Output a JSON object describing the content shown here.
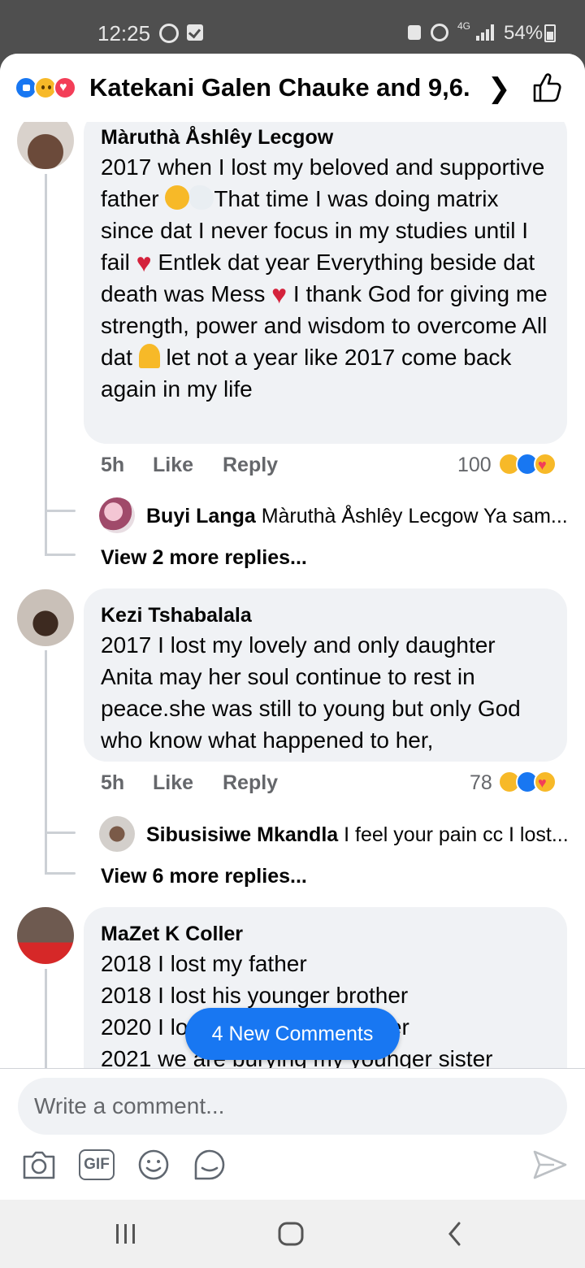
{
  "status_bar": {
    "time": "12:25",
    "network": "4G",
    "battery": "54%",
    "icons": [
      "whatsapp-icon",
      "notification-check-icon",
      "lock-icon",
      "alarm-icon",
      "signal-icon",
      "battery-icon"
    ]
  },
  "header": {
    "title": "Katekani Galen Chauke and 9,6...",
    "reactions": [
      "like",
      "sad",
      "love"
    ]
  },
  "comments": [
    {
      "author": "Màruthà Åshlêy Lecgow",
      "text_parts": [
        "2017 when I lost my beloved and supportive father ",
        "That time I was doing matrix since dat I never focus in my studies until I fail ",
        " Entlek dat year Everything beside dat death was Mess ",
        " I thank God for giving me strength, power and wisdom to overcome All dat ",
        " let not a year like 2017 come back again in my life"
      ],
      "time": "5h",
      "like": "Like",
      "reply": "Reply",
      "reaction_count": "100",
      "reply_preview": {
        "author": "Buyi Langa",
        "text": "Màruthà Åshlêy Lecgow Ya sam..."
      },
      "view_more": "View 2 more replies..."
    },
    {
      "author": "Kezi Tshabalala",
      "text": "2017 I lost my lovely and only daughter Anita may her soul continue to rest in peace.she was still to young but only God who know what happened to her,",
      "time": "5h",
      "like": "Like",
      "reply": "Reply",
      "reaction_count": "78",
      "reply_preview": {
        "author": "Sibusisiwe Mkandla",
        "text": "I feel your pain cc I lost..."
      },
      "view_more": "View 6 more replies..."
    },
    {
      "author": "MaZet K Coller",
      "lines": [
        "2018 I lost my father",
        "2018 I lost his younger brother",
        "2020 I lost my younger brother",
        "2021 we are burying my younger sister"
      ]
    }
  ],
  "new_comments_label": "4 New Comments",
  "composer": {
    "placeholder": "Write a comment...",
    "tools": [
      "camera-icon",
      "gif-icon",
      "emoji-icon",
      "sticker-icon"
    ],
    "gif_label": "GIF"
  },
  "colors": {
    "accent": "#1877f2",
    "bubble": "#f0f2f5",
    "secondary_text": "#65676b"
  }
}
